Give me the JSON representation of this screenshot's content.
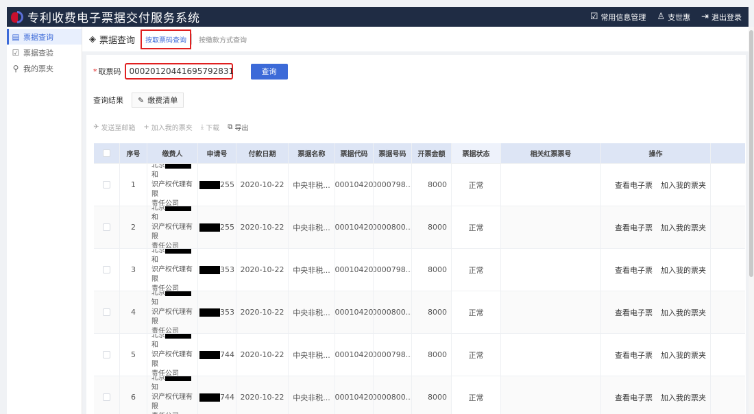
{
  "app": {
    "title": "专利收费电子票据交付服务系统"
  },
  "header": {
    "info_label": "常用信息管理",
    "user_label": "支世惠",
    "logout_label": "退出登录"
  },
  "sidebar": {
    "items": [
      {
        "label": "票据查询",
        "icon": "list-icon",
        "active": true
      },
      {
        "label": "票据查验",
        "icon": "check-icon",
        "active": false
      },
      {
        "label": "我的票夹",
        "icon": "search-icon",
        "active": false
      }
    ]
  },
  "tabs": {
    "title": "票据查询",
    "items": [
      {
        "label": "按取票码查询",
        "active": true
      },
      {
        "label": "按缴款方式查询",
        "active": false
      }
    ]
  },
  "search": {
    "field_label": "取票码",
    "value": "00020120441695792831",
    "query_button": "查询"
  },
  "results": {
    "label": "查询结果",
    "list_button": "缴费清单"
  },
  "actions": {
    "send_email": "发送至邮箱",
    "add_to_folder": "加入我的票夹",
    "download": "下载",
    "export": "导出"
  },
  "table": {
    "columns": [
      "序号",
      "缴费人",
      "申请号",
      "付款日期",
      "票据名称",
      "票据代码",
      "票据号码",
      "开票金额",
      "票据状态",
      "相关红票票号",
      "操作"
    ],
    "rows": [
      {
        "index": "1",
        "payer_line1": "北京",
        "payer_line1_end": "和",
        "payer_line2": "识产权代理有限",
        "payer_line3": "责任公司",
        "app_no_suffix": "255",
        "date": "2020-10-22",
        "bill_name": "中央非税...",
        "bill_code": "00010420",
        "bill_no": "0000798...",
        "amount": "8000",
        "status": "正常",
        "red_no": ""
      },
      {
        "index": "2",
        "payer_line1": "北京",
        "payer_line1_end": "和",
        "payer_line2": "识产权代理有限",
        "payer_line3": "责任公司",
        "app_no_suffix": "255",
        "date": "2020-10-22",
        "bill_name": "中央非税...",
        "bill_code": "00010420",
        "bill_no": "0000800...",
        "amount": "8000",
        "status": "正常",
        "red_no": ""
      },
      {
        "index": "3",
        "payer_line1": "北京",
        "payer_line1_end": "和",
        "payer_line2": "识产权代理有限",
        "payer_line3": "责任公司",
        "app_no_suffix": "353",
        "date": "2020-10-22",
        "bill_name": "中央非税...",
        "bill_code": "00010420",
        "bill_no": "0000798...",
        "amount": "8000",
        "status": "正常",
        "red_no": ""
      },
      {
        "index": "4",
        "payer_line1": "北京",
        "payer_line1_end": "知",
        "payer_line2": "识产权代理有限",
        "payer_line3": "责任公司",
        "app_no_suffix": "353",
        "date": "2020-10-22",
        "bill_name": "中央非税...",
        "bill_code": "00010420",
        "bill_no": "0000800...",
        "amount": "8000",
        "status": "正常",
        "red_no": ""
      },
      {
        "index": "5",
        "payer_line1": "北京",
        "payer_line1_end": "和",
        "payer_line2": "识产权代理有限",
        "payer_line3": "责任公司",
        "app_no_suffix": "744",
        "date": "2020-10-22",
        "bill_name": "中央非税...",
        "bill_code": "00010420",
        "bill_no": "0000798...",
        "amount": "8000",
        "status": "正常",
        "red_no": ""
      },
      {
        "index": "6",
        "payer_line1": "北京",
        "payer_line1_end": "知",
        "payer_line2": "识产权代理有限",
        "payer_line3": "责任公司",
        "app_no_suffix": "744",
        "date": "2020-10-22",
        "bill_name": "中央非税...",
        "bill_code": "00010420",
        "bill_no": "0000800...",
        "amount": "8000",
        "status": "正常",
        "red_no": ""
      }
    ],
    "op_view": "查看电子票",
    "op_add": "加入我的票夹"
  },
  "colors": {
    "topbar": "#1f2c44",
    "accent": "#3c6ad8",
    "highlight": "#e02020",
    "header_row": "#dde5f5"
  }
}
